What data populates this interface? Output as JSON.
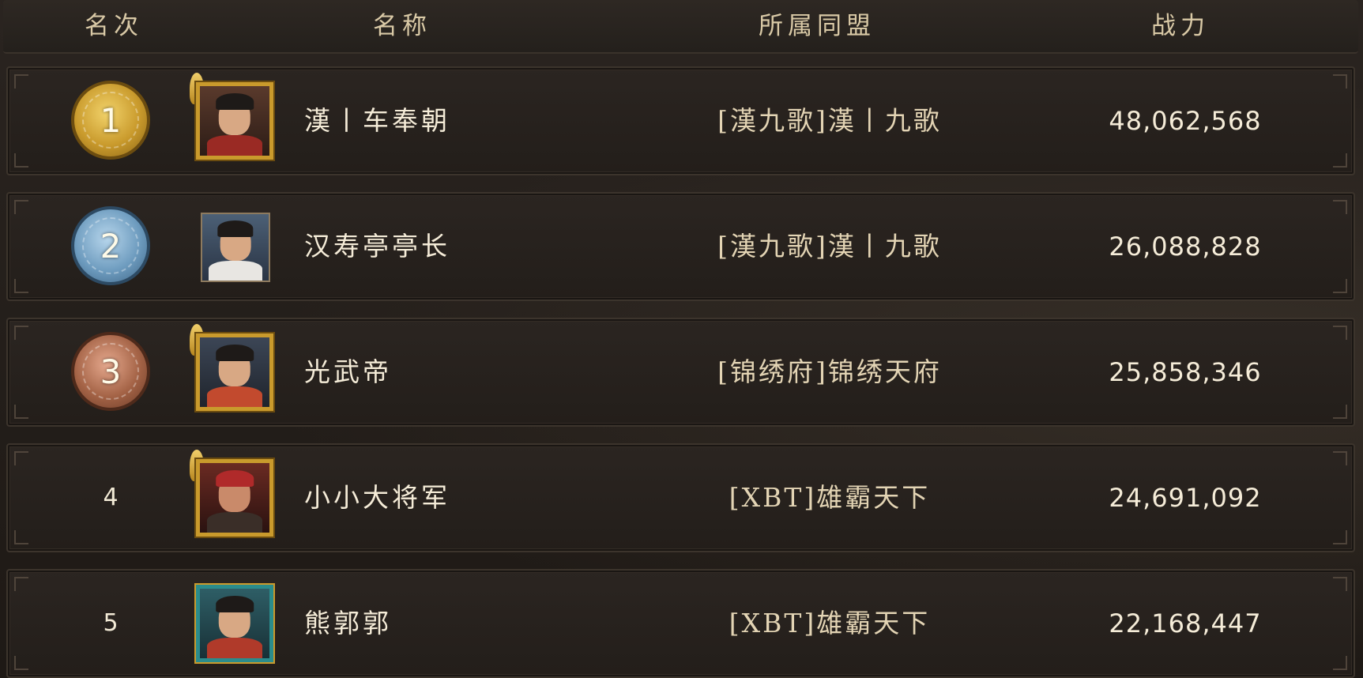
{
  "header": {
    "rank": "名次",
    "name": "名称",
    "alliance": "所属同盟",
    "power": "战力"
  },
  "rows": [
    {
      "rank": "1",
      "rank_style": "gold",
      "avatar_frame": "gold",
      "name": "漢丨车奉朝",
      "alliance": "[漢九歌]漢丨九歌",
      "power": "48,062,568"
    },
    {
      "rank": "2",
      "rank_style": "silver",
      "avatar_frame": "plain",
      "name": "汉寿亭亭长",
      "alliance": "[漢九歌]漢丨九歌",
      "power": "26,088,828"
    },
    {
      "rank": "3",
      "rank_style": "bronze",
      "avatar_frame": "gold",
      "name": "光武帝",
      "alliance": "[锦绣府]锦绣天府",
      "power": "25,858,346"
    },
    {
      "rank": "4",
      "rank_style": "plain",
      "avatar_frame": "gold",
      "name": "小小大将军",
      "alliance": "[XBT]雄霸天下",
      "power": "24,691,092"
    },
    {
      "rank": "5",
      "rank_style": "plain",
      "avatar_frame": "teal",
      "name": "熊郭郭",
      "alliance": "[XBT]雄霸天下",
      "power": "22,168,447"
    }
  ],
  "colors": {
    "gold": "#c99a2c",
    "silver": "#6e9cbf",
    "bronze": "#a46346",
    "text": "#f5ecd8",
    "header_text": "#d9c9a6"
  }
}
